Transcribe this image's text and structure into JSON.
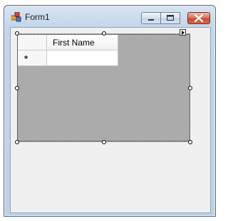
{
  "window": {
    "title": "Form1",
    "minimize_glyph": "▁",
    "maximize_glyph": "▭",
    "close_glyph": "✕"
  },
  "grid": {
    "columns": [
      "First Name"
    ],
    "new_row_marker": "*",
    "new_row_value": ""
  },
  "icons": {
    "app": "form-app-icon",
    "smart_tag": "smart-tag-arrow-icon"
  }
}
